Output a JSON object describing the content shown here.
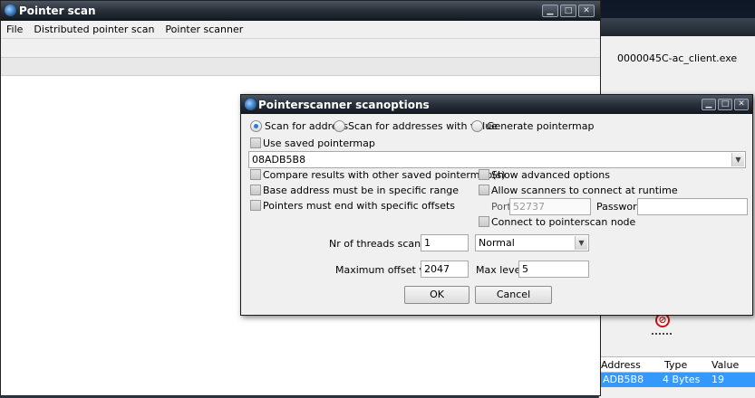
{
  "background_window": {
    "process": "0000045C-ac_client.exe",
    "stop_icon": "no-entry-icon",
    "columns": [
      "Address",
      "Type",
      "Value"
    ],
    "row": {
      "address": "ADB5B8",
      "type": "4 Bytes",
      "value": "19"
    },
    "highlight_color": "#3399ff"
  },
  "pointer_scan": {
    "title": "Pointer scan",
    "menu": [
      "File",
      "Distributed pointer scan",
      "Pointer scanner"
    ],
    "caption_buttons": [
      "minimize-icon",
      "maximize-icon",
      "close-icon"
    ]
  },
  "dialog": {
    "title": "Pointerscanner scanoptions",
    "radios": {
      "scan_for_address": "Scan for address",
      "scan_for_addresses_with_value": "Scan for addresses with value",
      "generate_pointermap": "Generate pointermap",
      "selected": "scan_for_address"
    },
    "use_saved_pointermap": "Use saved pointermap",
    "address_value": "08ADB5B8",
    "left_checks": [
      "Compare results with other saved pointermap(s)",
      "Base address must be in specific range",
      "Pointers must end with specific offsets"
    ],
    "right_checks": {
      "show_advanced": "Show advanced options",
      "allow_scanners": "Allow scanners to connect at runtime",
      "connect_node": "Connect to pointerscan node"
    },
    "port_label": "Port",
    "port_value": "52737",
    "password_label": "Password",
    "password_value": "",
    "threads_label": "Nr of threads scanning:",
    "threads_value": "1",
    "priority_value": "Normal",
    "max_offset_label": "Maximum offset value:",
    "max_offset_value": "2047",
    "max_level_label": "Max level",
    "max_level_value": "5",
    "ok_label": "OK",
    "cancel_label": "Cancel",
    "accent_color": "#2a7ad8"
  }
}
